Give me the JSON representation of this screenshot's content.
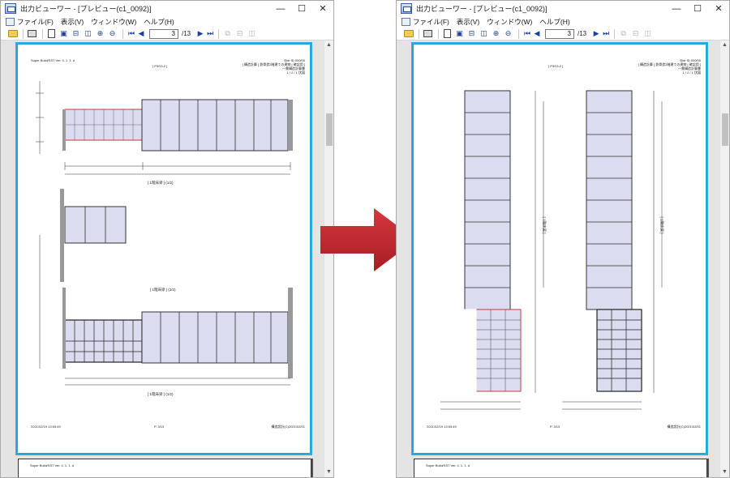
{
  "window": {
    "title": "出力ビューワー - [プレビュー(c1_0092)]",
    "controls": {
      "minimize": "—",
      "maximize": "☐",
      "close": "✕"
    }
  },
  "menu": [
    {
      "label": "ファイル(F)"
    },
    {
      "label": "表示(V)"
    },
    {
      "label": "ウィンドウ(W)"
    },
    {
      "label": "ヘルプ(H)"
    }
  ],
  "toolbar": {
    "current_page": "3",
    "page_total": "/13",
    "icons": [
      "open-icon",
      "print-icon",
      "page-setup-icon",
      "fit-page-icon",
      "fit-width-icon",
      "two-page-icon",
      "zoom-in-icon",
      "zoom-out-icon",
      "first-page-icon",
      "prev-page-icon",
      "next-page-icon",
      "last-page-icon",
      "disabled-view-icons"
    ]
  },
  "left_page": {
    "header_left": "Super Build/SS7 Ver. 4. 1. 1. d",
    "header_title": "[ P3G3-2 ]",
    "header_right_1": "Bldr ID 000/00",
    "header_right_2": "[ 構造計算 ] 鉄骨造2階建ての建物 [ 確認用 ]",
    "header_right_3": "一貫構造計算書",
    "header_right_4": "1 / 2 / 1 伏図",
    "section_1_caption": "[ 1階床梁 ] (1/2)",
    "section_2_caption": "[ 1階床梁 ] (2/2)",
    "section_3_caption": "[ 1階床梁 ] (1/2)",
    "footer_left": "2021/02/19 13:53:49",
    "footer_center": "P. 3/13",
    "footer_right": "構造設計(C)2021/02/01"
  },
  "right_page": {
    "header_title": "[ P3G3-2 ]",
    "header_right_1": "Bldr ID 000/00",
    "header_right_2": "[ 構造計算 ] 鉄骨造2階建ての建物 [ 確認用 ]",
    "header_right_3": "一貫構造計算書",
    "header_right_4": "1 / 2 / 1 伏図",
    "caption_left": "[ 1階床梁 ]",
    "caption_right": "[ 1階床梁 ]",
    "footer_left": "2021/02/19 13:53:49",
    "footer_center": "P. 3/13",
    "footer_right": "構造設計(C)2021/02/01"
  },
  "next_page_header": "Super Build/SS7 Ver. 4. 1. 1. d",
  "colors": {
    "page_border": "#23a6d8",
    "arrow": "#c0272d",
    "room_fill": "#dcdcf0",
    "highlight_outline": "#c83a3a"
  }
}
